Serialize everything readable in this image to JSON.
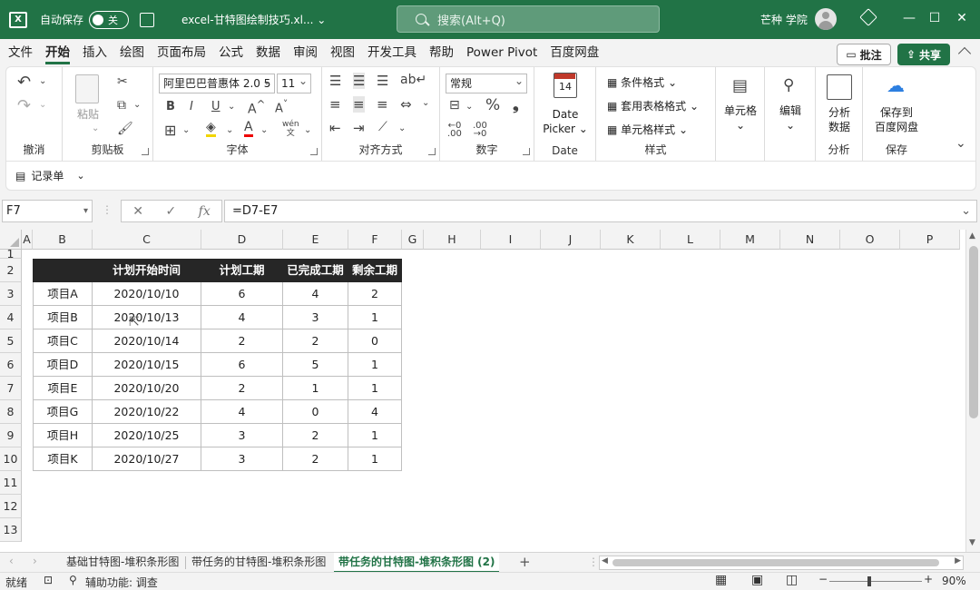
{
  "titlebar": {
    "autosave_label": "自动保存",
    "autosave_state": "关",
    "doc_title": "excel-甘特图绘制技巧.xl...",
    "search_placeholder": "搜索(Alt+Q)",
    "user_name": "芒种 学院"
  },
  "menu": {
    "items": [
      "文件",
      "开始",
      "插入",
      "绘图",
      "页面布局",
      "公式",
      "数据",
      "审阅",
      "视图",
      "开发工具",
      "帮助",
      "Power Pivot",
      "百度网盘"
    ],
    "active": "开始",
    "comment_button": "批注",
    "share_button": "共享"
  },
  "ribbon": {
    "undo_label": "撤消",
    "clipboard": {
      "paste": "粘贴",
      "label": "剪贴板"
    },
    "font": {
      "name": "阿里巴巴普惠体 2.0 5",
      "size": "11",
      "label": "字体"
    },
    "alignment": {
      "label": "对齐方式"
    },
    "number": {
      "format": "常规",
      "label": "数字"
    },
    "date": {
      "big": "Date",
      "big2": "Picker",
      "label": "Date",
      "calendar_day": "14"
    },
    "styles": {
      "conditional": "条件格式",
      "table": "套用表格格式",
      "cell": "单元格样式",
      "label": "样式"
    },
    "cells": {
      "label": "单元格"
    },
    "editing": {
      "label": "编辑"
    },
    "analysis": {
      "big": "分析",
      "big2": "数据",
      "label": "分析"
    },
    "save": {
      "big": "保存到",
      "big2": "百度网盘",
      "label": "保存"
    }
  },
  "qat": {
    "record_label": "记录单"
  },
  "formula_bar": {
    "name_box": "F7",
    "formula": "=D7-E7"
  },
  "sheet": {
    "columns": [
      "A",
      "B",
      "C",
      "D",
      "E",
      "F",
      "G",
      "H",
      "I",
      "J",
      "K",
      "L",
      "M",
      "N",
      "O",
      "P"
    ],
    "rows": [
      "1",
      "2",
      "3",
      "4",
      "5",
      "6",
      "7",
      "8",
      "9",
      "10",
      "11",
      "12",
      "13"
    ],
    "table_headers": [
      "",
      "计划开始时间",
      "计划工期",
      "已完成工期",
      "剩余工期"
    ],
    "table_rows": [
      [
        "项目A",
        "2020/10/10",
        "6",
        "4",
        "2"
      ],
      [
        "项目B",
        "2020/10/13",
        "4",
        "3",
        "1"
      ],
      [
        "项目C",
        "2020/10/14",
        "2",
        "2",
        "0"
      ],
      [
        "项目D",
        "2020/10/15",
        "6",
        "5",
        "1"
      ],
      [
        "项目E",
        "2020/10/20",
        "2",
        "1",
        "1"
      ],
      [
        "项目G",
        "2020/10/22",
        "4",
        "0",
        "4"
      ],
      [
        "项目H",
        "2020/10/25",
        "3",
        "2",
        "1"
      ],
      [
        "项目K",
        "2020/10/27",
        "3",
        "2",
        "1"
      ]
    ]
  },
  "tabs": {
    "items": [
      "基础甘特图-堆积条形图",
      "带任务的甘特图-堆积条形图",
      "带任务的甘特图-堆积条形图 (2)"
    ],
    "active_index": 2
  },
  "status": {
    "ready": "就绪",
    "accessibility": "辅助功能: 调查",
    "zoom": "90%"
  }
}
